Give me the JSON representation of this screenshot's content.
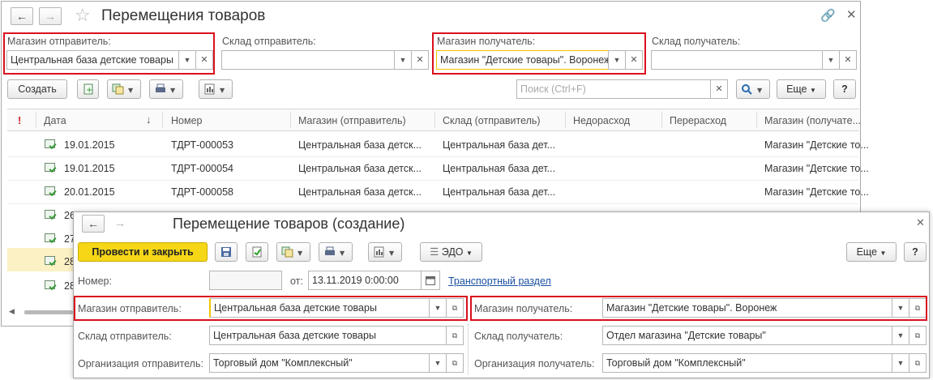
{
  "list_window": {
    "title": "Перемещения товаров",
    "filters": {
      "sender_store_label": "Магазин отправитель:",
      "sender_store_value": "Центральная база детские товары",
      "sender_wh_label": "Склад отправитель:",
      "sender_wh_value": "",
      "recv_store_label": "Магазин получатель:",
      "recv_store_value": "Магазин \"Детские товары\". Воронеж",
      "recv_wh_label": "Склад получатель:",
      "recv_wh_value": ""
    },
    "toolbar": {
      "create_label": "Создать",
      "search_placeholder": "Поиск (Ctrl+F)",
      "more_label": "Еще",
      "help_label": "?"
    },
    "table": {
      "columns": [
        "!",
        "Дата",
        "Номер",
        "Магазин (отправитель)",
        "Склад (отправитель)",
        "Недорасход",
        "Перерасход",
        "Магазин (получате..."
      ],
      "rows": [
        {
          "date": "19.01.2015",
          "number": "ТДРТ-000053",
          "sender_store": "Центральная база детск...",
          "sender_wh": "Центральная база дет...",
          "recv_store": "Магазин \"Детские то..."
        },
        {
          "date": "19.01.2015",
          "number": "ТДРТ-000054",
          "sender_store": "Центральная база детск...",
          "sender_wh": "Центральная база дет...",
          "recv_store": "Магазин \"Детские то..."
        },
        {
          "date": "20.01.2015",
          "number": "ТДРТ-000058",
          "sender_store": "Центральная база детск...",
          "sender_wh": "Центральная база дет...",
          "recv_store": "Магазин \"Детские то..."
        },
        {
          "date": "26"
        },
        {
          "date": "27"
        },
        {
          "date": "28"
        },
        {
          "date": "28"
        }
      ]
    }
  },
  "form_window": {
    "title": "Перемещение товаров (создание)",
    "toolbar": {
      "post_close_label": "Провести и закрыть",
      "edo_label": "ЭДО",
      "more_label": "Еще",
      "help_label": "?"
    },
    "number_label": "Номер:",
    "number_value": "",
    "date_from_label": "от:",
    "date_value": "13.11.2019  0:00:00",
    "transport_link": "Транспортный раздел",
    "sender_store_label": "Магазин отправитель:",
    "sender_store_value": "Центральная база детские товары",
    "recv_store_label": "Магазин получатель:",
    "recv_store_value": "Магазин \"Детские товары\". Воронеж",
    "sender_wh_label": "Склад отправитель:",
    "sender_wh_value": "Центральная база детские товары",
    "recv_wh_label": "Склад получатель:",
    "recv_wh_value": "Отдел магазина \"Детские товары\"",
    "sender_org_label": "Организация отправитель:",
    "sender_org_value": "Торговый дом \"Комплексный\"",
    "recv_org_label": "Организация получатель:",
    "recv_org_value": "Торговый дом \"Комплексный\""
  },
  "colors": {
    "highlight_red": "#d9101d",
    "primary_yellow": "#f5d718",
    "link_blue": "#1a4fa0"
  }
}
